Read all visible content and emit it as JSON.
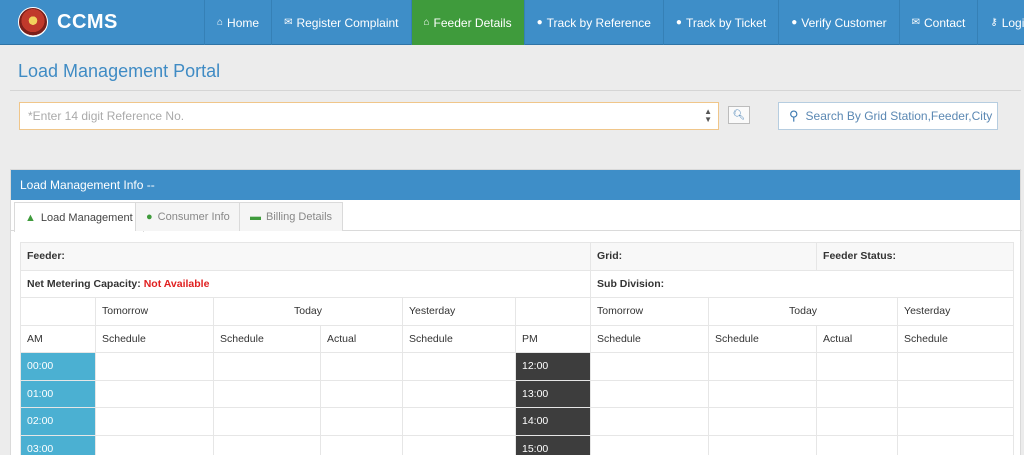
{
  "brand": {
    "name": "CCMS"
  },
  "nav": [
    {
      "icon": "home-icon",
      "glyph": "⌂",
      "label": "Home"
    },
    {
      "icon": "comments-icon",
      "glyph": "✉",
      "label": "Register Complaint"
    },
    {
      "icon": "home-icon",
      "glyph": "⌂",
      "label": "Feeder Details",
      "active": true
    },
    {
      "icon": "comment-icon",
      "glyph": "●",
      "label": "Track by Reference"
    },
    {
      "icon": "comment-icon",
      "glyph": "●",
      "label": "Track by Ticket"
    },
    {
      "icon": "comment-icon",
      "glyph": "●",
      "label": "Verify Customer"
    },
    {
      "icon": "envelope-icon",
      "glyph": "✉",
      "label": "Contact"
    },
    {
      "icon": "key-icon",
      "glyph": "⚷",
      "label": "Login"
    }
  ],
  "portal": {
    "title": "Load Management Portal",
    "reference_placeholder": "*Enter 14 digit Reference No.",
    "grid_search_placeholder": "Search By Grid Station,Feeder,City"
  },
  "panel": {
    "title": "Load Management Info --",
    "tabs": [
      "Load Management",
      "Consumer Info",
      "Billing Details"
    ]
  },
  "info": {
    "feeder_label": "Feeder:",
    "grid_label": "Grid:",
    "feeder_status_label": "Feeder Status:",
    "net_metering_label": "Net Metering Capacity:",
    "net_metering_value": "Not Available",
    "sub_division_label": "Sub Division:"
  },
  "schedule": {
    "day_headers": [
      "Tomorrow",
      "Today",
      "Yesterday"
    ],
    "am_label": "AM",
    "pm_label": "PM",
    "schedule_label": "Schedule",
    "actual_label": "Actual",
    "am_times": [
      "00:00",
      "01:00",
      "02:00",
      "03:00"
    ],
    "pm_times": [
      "12:00",
      "13:00",
      "14:00",
      "15:00"
    ]
  },
  "colors": {
    "primary": "#3e8ec8",
    "active_nav": "#3f9b3c",
    "am_cell": "#4bb0d2",
    "pm_cell": "#3d3d3d",
    "alert": "#e02020"
  }
}
